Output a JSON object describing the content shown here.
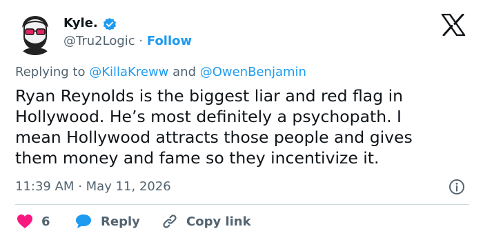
{
  "author": {
    "name": "Kyle.",
    "handle": "@Tru2Logic",
    "separator": "·",
    "follow_label": "Follow",
    "verified_color": "#1d9bf0"
  },
  "reply_context": {
    "prefix": "Replying to",
    "mention1": "@KillaKreww",
    "conjunction": "and",
    "mention2": "@OwenBenjamin"
  },
  "tweet": {
    "text": "Ryan Reynolds is the biggest liar and red flag in\nHollywood. He’s most definitely a psychopath. I\nmean Hollywood attracts those people and gives\nthem money and fame so they incentivize it.",
    "time": "11:39 AM",
    "dot": "·",
    "date": "May 11, 2026"
  },
  "actions": {
    "like_count": "6",
    "reply_label": "Reply",
    "copy_label": "Copy link"
  },
  "icons": {
    "logo": "x-logo-icon",
    "info": "info-icon",
    "like": "heart-icon",
    "reply": "speech-bubble-icon",
    "copy": "link-icon"
  },
  "colors": {
    "text": "#0f1419",
    "secondary": "#536471",
    "accent": "#1d9bf0",
    "heart": "#f91880",
    "divider": "#cfd9de"
  }
}
